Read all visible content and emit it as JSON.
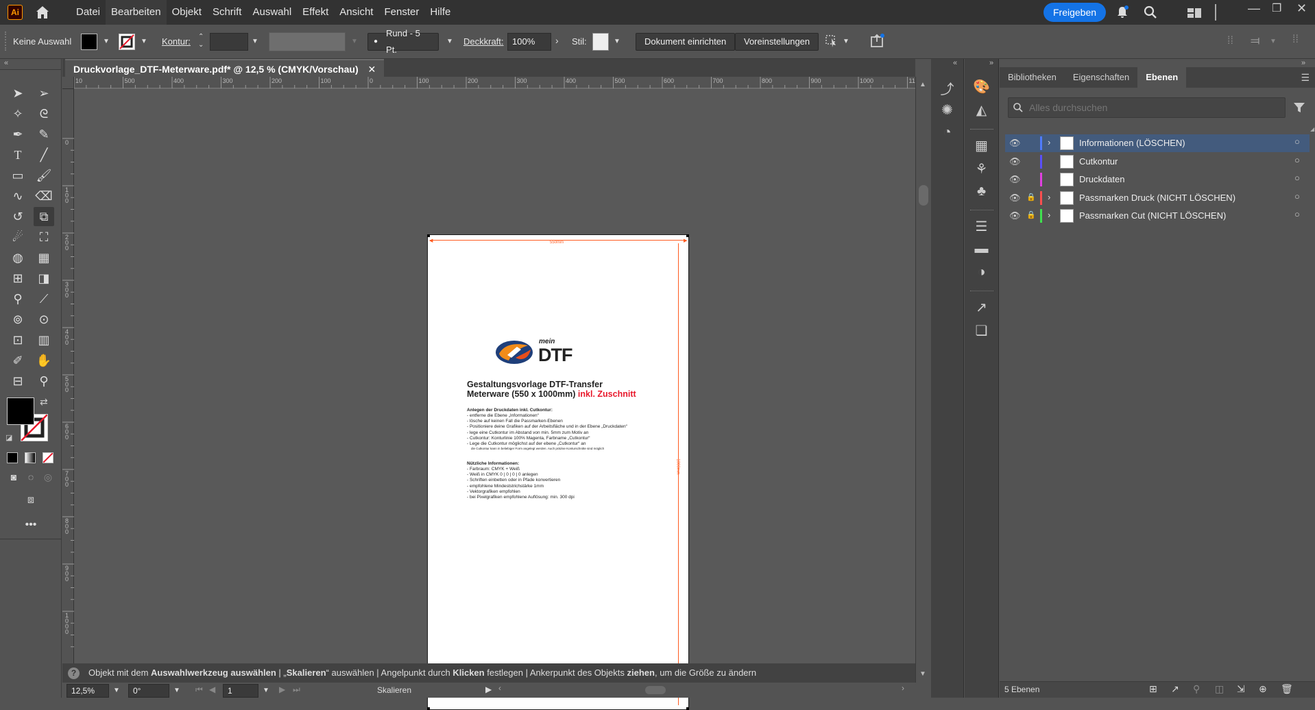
{
  "app": {
    "logo": "Ai",
    "home_icon": "home-icon"
  },
  "menu": [
    "Datei",
    "Bearbeiten",
    "Objekt",
    "Schrift",
    "Auswahl",
    "Effekt",
    "Ansicht",
    "Fenster",
    "Hilfe"
  ],
  "header": {
    "share_label": "Freigeben"
  },
  "control_bar": {
    "selection": "Keine Auswahl",
    "stroke_label": "Kontur:",
    "brush": "Rund - 5 Pt.",
    "opacity_label": "Deckkraft:",
    "opacity_value": "100%",
    "style_label": "Stil:",
    "doc_setup": "Dokument einrichten",
    "preferences": "Voreinstellungen"
  },
  "document": {
    "tab_title": "Druckvorlage_DTF-Meterware.pdf* @ 12,5 % (CMYK/Vorschau)"
  },
  "ruler_h": [
    "10",
    "500",
    "400",
    "300",
    "200",
    "100",
    "0",
    "100",
    "200",
    "300",
    "400",
    "500",
    "600",
    "700",
    "800",
    "900",
    "1000",
    "1100"
  ],
  "ruler_v": [
    "0",
    "1 0 0",
    "2 0 0",
    "3 0 0",
    "4 0 0",
    "5 0 0",
    "6 0 0",
    "7 0 0",
    "8 0 0",
    "9 0 0",
    "1 0 0 0"
  ],
  "artboard": {
    "width_dim": "550mm",
    "height_dim": "1000mm",
    "logo_small": "mein",
    "logo_big": "DTF",
    "title_line1": "Gestaltungsvorlage DTF-Transfer",
    "title_line2": "Meterware (550 x 1000mm)",
    "title_highlight": "inkl. Zuschnitt",
    "section1_title": "Anlegen der Druckdaten inkl. Cutkontur:",
    "section1_lines": [
      "- entferne die Ebene „Informationen“",
      "- lösche auf keinen Fall die Passmarken-Ebenen",
      "- Positioniere deine Grafiken auf der Arbeitsfläche und in der Ebene „Druckdaten“",
      "- lege eine Cutkontur im Abstand von min. 5mm zum Motiv an",
      "- Cutkontur: Konturlinie 100% Magenta, Farbname „Cutkontur“",
      "- Lege die Cutkontur möglichst auf der ebene „Cutkontur“ an"
    ],
    "section1_note": "die Cutkontur kann in beliebiger Form angelegt werden. Auch präzise Konturschnitte sind möglich",
    "section2_title": "Nützliche Informationen:",
    "section2_lines": [
      "- Farbraum: CMYK + Weiß",
      "- Weiß in CMYK 0 | 0 | 0 | 0 anlegen",
      "- Schriften einbetten oder in Pfade konvertieren",
      "- empfohlene Mindeststrichstärke 1mm",
      "- Vektorgrafiken empfohlen",
      "- bei Pixelgrafiken empfohlene Auflösung: min. 300 dpi"
    ]
  },
  "status": {
    "p1": "Objekt mit dem ",
    "b1": "Auswahlwerkzeug auswählen",
    "p2": " | „",
    "b2": "Skalieren",
    "p3": "“ auswählen | Angelpunkt durch ",
    "b3": "Klicken",
    "p4": " festlegen | Ankerpunkt des Objekts ",
    "b4": "ziehen",
    "p5": ", um die Größe zu ändern"
  },
  "bottom": {
    "zoom": "12,5%",
    "rotation": "0°",
    "artboard_num": "1",
    "tool_name": "Skalieren"
  },
  "panel": {
    "tabs": [
      "Bibliotheken",
      "Eigenschaften",
      "Ebenen"
    ],
    "search_placeholder": "Alles durchsuchen",
    "layers": [
      {
        "name": "Informationen (LÖSCHEN)",
        "color": "#4f7bff",
        "locked": false,
        "expandable": true,
        "selected": true
      },
      {
        "name": "Cutkontur",
        "color": "#5a4fff",
        "locked": false,
        "expandable": false,
        "selected": false
      },
      {
        "name": "Druckdaten",
        "color": "#e040e0",
        "locked": false,
        "expandable": false,
        "selected": false
      },
      {
        "name": "Passmarken Druck (NICHT LÖSCHEN)",
        "color": "#ff4f4f",
        "locked": true,
        "expandable": true,
        "selected": false
      },
      {
        "name": "Passmarken Cut (NICHT LÖSCHEN)",
        "color": "#3fe04f",
        "locked": true,
        "expandable": true,
        "selected": false
      }
    ],
    "footer_count": "5 Ebenen"
  },
  "colors": {
    "accent": "#1473e6",
    "dimension": "#ff5a1f",
    "highlight_red": "#e8192c"
  }
}
